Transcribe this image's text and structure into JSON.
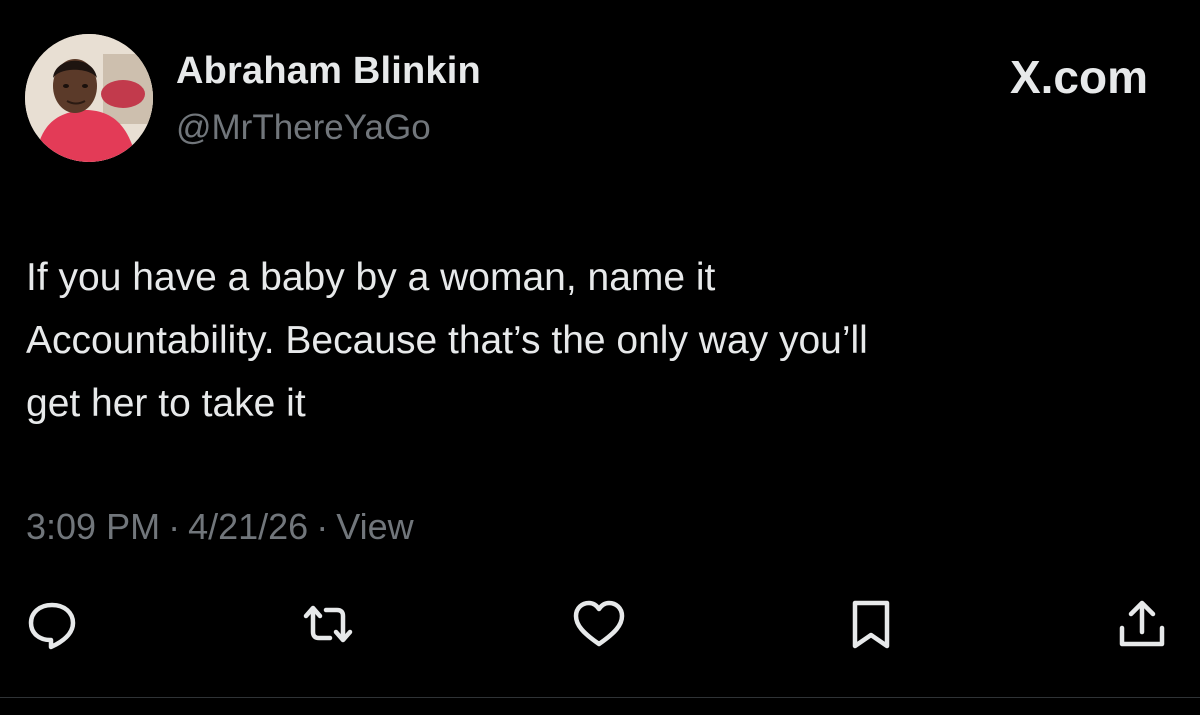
{
  "brand": "X.com",
  "author": {
    "display_name": "Abraham Blinkin",
    "handle": "@MrThereYaGo"
  },
  "tweet": {
    "lines": [
      "If you have a baby by a woman, name it",
      "Accountability. Because that’s the only way you’ll",
      "get her to take it"
    ]
  },
  "meta": {
    "time": "3:09 PM",
    "date": "4/21/26",
    "separator": "·",
    "views_label": "View"
  },
  "actions": [
    {
      "name": "reply",
      "icon": "reply-icon"
    },
    {
      "name": "repost",
      "icon": "repost-icon"
    },
    {
      "name": "like",
      "icon": "heart-icon"
    },
    {
      "name": "bookmark",
      "icon": "bookmark-icon"
    },
    {
      "name": "share",
      "icon": "share-icon"
    }
  ],
  "colors": {
    "background": "#000000",
    "primary_text": "#e7e9ea",
    "secondary_text": "#71767b",
    "divider": "#2f3336"
  }
}
